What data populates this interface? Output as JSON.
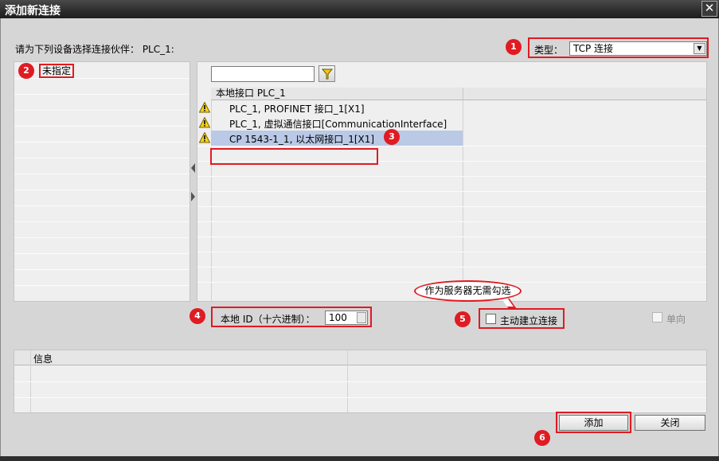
{
  "window": {
    "title": "添加新连接",
    "close_glyph": "✕"
  },
  "prompt": "请为下列设备选择连接伙伴： PLC_1:",
  "type_selector": {
    "label": "类型：",
    "value": "TCP 连接"
  },
  "left_panel": {
    "items": [
      "未指定"
    ]
  },
  "right_panel": {
    "filter_placeholder": "",
    "column_header": "本地接口 PLC_1",
    "rows": [
      {
        "text": "PLC_1, PROFINET 接口_1[X1]",
        "icon": "warning-icon",
        "selected": false
      },
      {
        "text": "PLC_1, 虚拟通信接口[CommunicationInterface]",
        "icon": "warning-icon",
        "selected": false
      },
      {
        "text": "CP 1543-1_1, 以太网接口_1[X1]",
        "icon": "warning-icon",
        "selected": true
      }
    ]
  },
  "local_id": {
    "label": "本地 ID（十六进制）：",
    "value": "100"
  },
  "callout": "作为服务器无需勾选",
  "active_connection": {
    "label": "主动建立连接",
    "checked": false
  },
  "unidirectional": {
    "label": "单向",
    "checked": false,
    "enabled": false
  },
  "info_panel": {
    "header": "信息"
  },
  "buttons": {
    "add": "添加",
    "close": "关闭"
  },
  "badges": [
    "1",
    "2",
    "3",
    "4",
    "5",
    "6"
  ],
  "colors": {
    "annotation_red": "#e01b22",
    "selection_blue": "#b9c9e6",
    "title_bar": "#2c2c2c"
  }
}
